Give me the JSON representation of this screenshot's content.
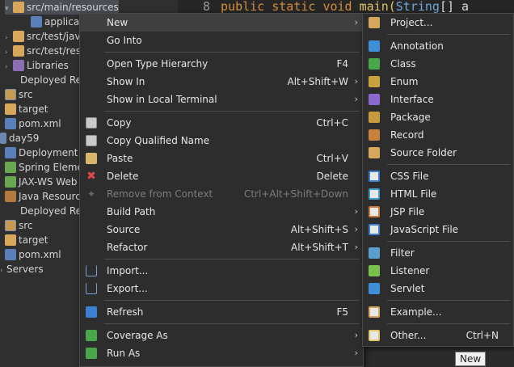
{
  "editor": {
    "line_number": "8",
    "code_public": "public",
    "code_static": "static",
    "code_void": "void",
    "code_main": "main(",
    "code_string": "String",
    "code_rest": "[] a"
  },
  "explorer": {
    "items": [
      {
        "label": "src/main/resources",
        "twisty": "▾",
        "icon": "folder-icon"
      },
      {
        "label": "applicat",
        "twisty": "",
        "icon": "xml-icon"
      },
      {
        "label": "src/test/jav",
        "twisty": "›",
        "icon": "folder-icon"
      },
      {
        "label": "src/test/res",
        "twisty": "›",
        "icon": "folder-icon"
      },
      {
        "label": "Libraries",
        "twisty": "›",
        "icon": "library-icon"
      },
      {
        "label": "Deployed Res",
        "twisty": "",
        "icon": ""
      },
      {
        "label": "src",
        "twisty": "",
        "icon": "source-folder-icon"
      },
      {
        "label": "target",
        "twisty": "",
        "icon": "folder-icon"
      },
      {
        "label": "pom.xml",
        "twisty": "",
        "icon": "xml-icon"
      },
      {
        "label": "day59",
        "twisty": "",
        "icon": "project-icon"
      },
      {
        "label": "Deployment I",
        "twisty": "",
        "icon": "deployment-icon"
      },
      {
        "label": "Spring Eleme",
        "twisty": "",
        "icon": "spring-icon"
      },
      {
        "label": "JAX-WS Web",
        "twisty": "",
        "icon": "jaxws-icon"
      },
      {
        "label": "Java Resource",
        "twisty": "",
        "icon": "java-resource-icon"
      },
      {
        "label": "Deployed Res",
        "twisty": "",
        "icon": ""
      },
      {
        "label": "src",
        "twisty": "",
        "icon": "source-folder-icon"
      },
      {
        "label": "target",
        "twisty": "",
        "icon": "folder-icon"
      },
      {
        "label": "pom.xml",
        "twisty": "",
        "icon": "xml-icon"
      },
      {
        "label": "Servers",
        "twisty": "›",
        "icon": "servers-icon"
      }
    ]
  },
  "context_menu": {
    "new": "New",
    "go_into": "Go Into",
    "open_type_hierarchy": "Open Type Hierarchy",
    "open_type_hierarchy_key": "F4",
    "show_in": "Show In",
    "show_in_key": "Alt+Shift+W",
    "show_in_terminal": "Show in Local Terminal",
    "copy": "Copy",
    "copy_key": "Ctrl+C",
    "copy_qualified": "Copy Qualified Name",
    "paste": "Paste",
    "paste_key": "Ctrl+V",
    "delete": "Delete",
    "delete_key": "Delete",
    "remove_context": "Remove from Context",
    "remove_context_key": "Ctrl+Alt+Shift+Down",
    "build_path": "Build Path",
    "source": "Source",
    "source_key": "Alt+Shift+S",
    "refactor": "Refactor",
    "refactor_key": "Alt+Shift+T",
    "import": "Import...",
    "export": "Export...",
    "refresh": "Refresh",
    "refresh_key": "F5",
    "coverage_as": "Coverage As",
    "run_as": "Run As",
    "arrow": "›"
  },
  "submenu": {
    "project": "Project...",
    "annotation": "Annotation",
    "class": "Class",
    "enum": "Enum",
    "interface": "Interface",
    "package": "Package",
    "record": "Record",
    "source_folder": "Source Folder",
    "css_file": "CSS File",
    "html_file": "HTML File",
    "jsp_file": "JSP File",
    "javascript_file": "JavaScript File",
    "filter": "Filter",
    "listener": "Listener",
    "servlet": "Servlet",
    "example": "Example...",
    "other": "Other...",
    "other_key": "Ctrl+N"
  },
  "tooltip": {
    "text": "New"
  }
}
